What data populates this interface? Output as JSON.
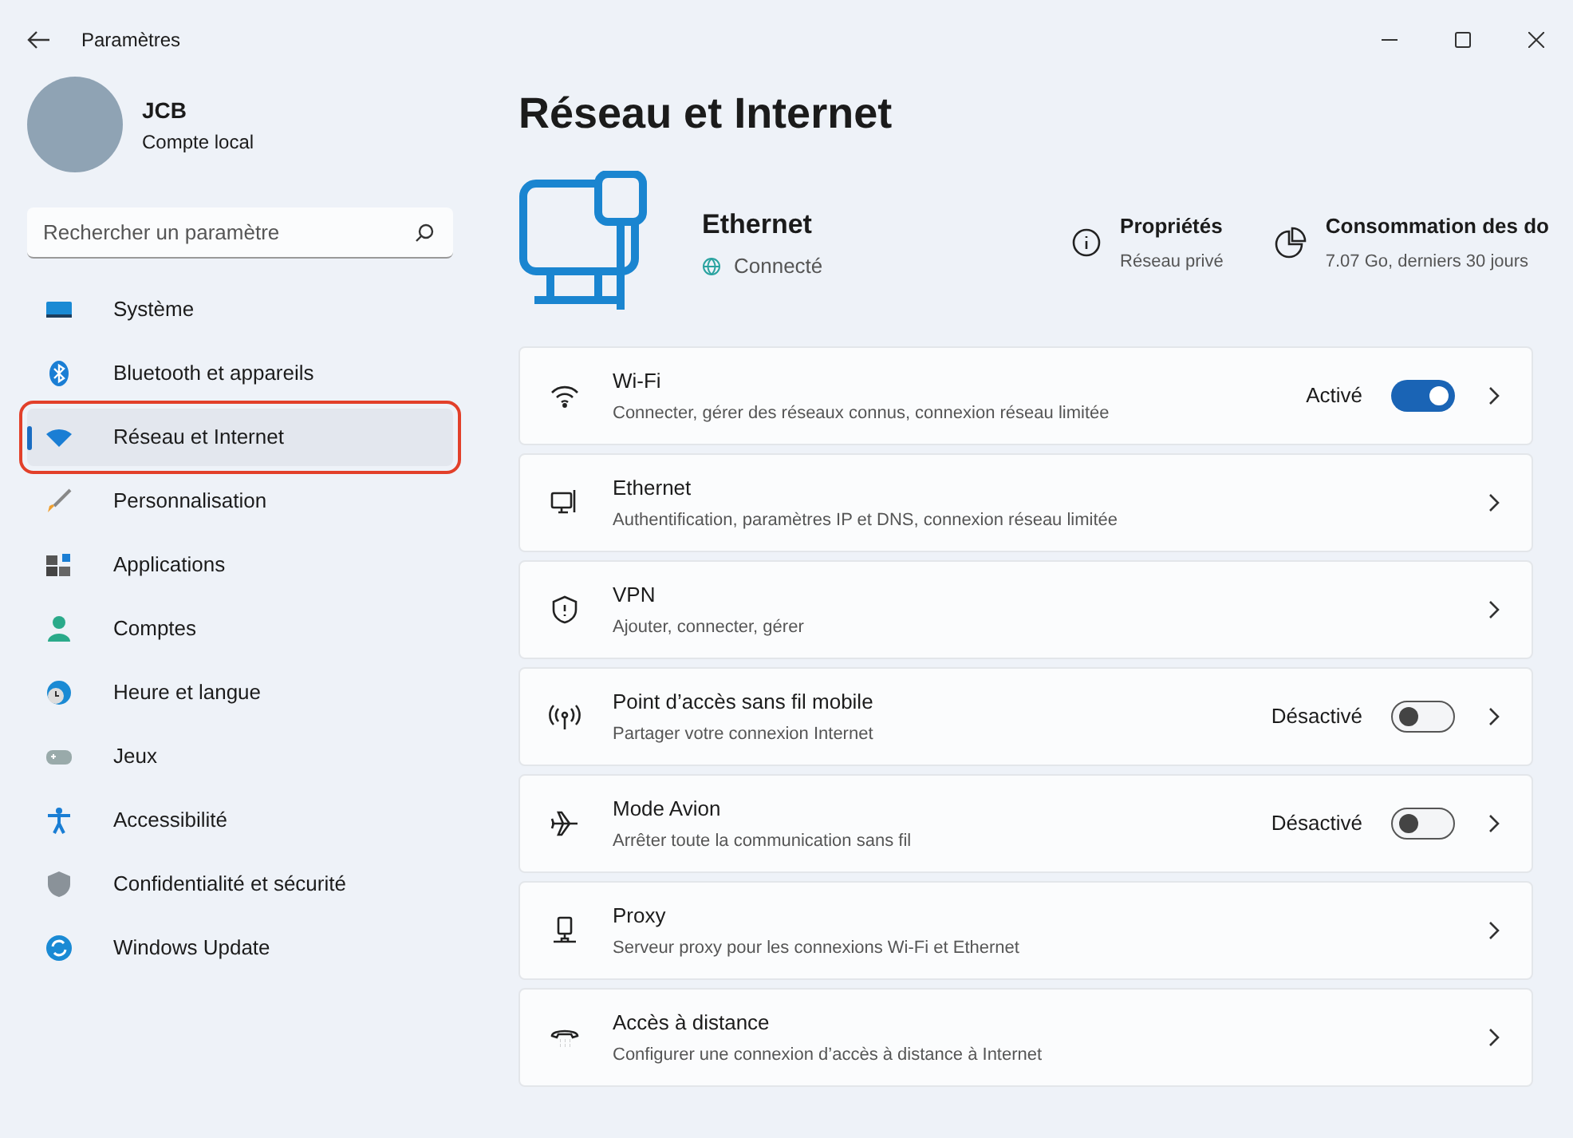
{
  "window": {
    "title": "Paramètres"
  },
  "user": {
    "name": "JCB",
    "account": "Compte local"
  },
  "search": {
    "placeholder": "Rechercher un paramètre"
  },
  "sidebar": {
    "items": [
      {
        "label": "Système",
        "selected": false,
        "highlighted": false
      },
      {
        "label": "Bluetooth et appareils",
        "selected": false,
        "highlighted": false
      },
      {
        "label": "Réseau et Internet",
        "selected": true,
        "highlighted": true
      },
      {
        "label": "Personnalisation",
        "selected": false,
        "highlighted": false
      },
      {
        "label": "Applications",
        "selected": false,
        "highlighted": false
      },
      {
        "label": "Comptes",
        "selected": false,
        "highlighted": false
      },
      {
        "label": "Heure et langue",
        "selected": false,
        "highlighted": false
      },
      {
        "label": "Jeux",
        "selected": false,
        "highlighted": false
      },
      {
        "label": "Accessibilité",
        "selected": false,
        "highlighted": false
      },
      {
        "label": "Confidentialité et sécurité",
        "selected": false,
        "highlighted": false
      },
      {
        "label": "Windows Update",
        "selected": false,
        "highlighted": false
      }
    ]
  },
  "page": {
    "title": "Réseau et Internet",
    "connection": {
      "name": "Ethernet",
      "status": "Connecté"
    },
    "properties": {
      "title": "Propriétés",
      "subtitle": "Réseau privé"
    },
    "usage": {
      "title": "Consommation des do",
      "subtitle": "7.07 Go, derniers 30 jours"
    }
  },
  "settings": [
    {
      "title": "Wi-Fi",
      "description": "Connecter, gérer des réseaux connus, connexion réseau limitée",
      "state_label": "Activé",
      "on": true
    },
    {
      "title": "Ethernet",
      "description": "Authentification, paramètres IP et DNS, connexion réseau limitée"
    },
    {
      "title": "VPN",
      "description": "Ajouter, connecter, gérer"
    },
    {
      "title": "Point d’accès sans fil mobile",
      "description": "Partager votre connexion Internet",
      "state_label": "Désactivé",
      "on": false
    },
    {
      "title": "Mode Avion",
      "description": "Arrêter toute la communication sans fil",
      "state_label": "Désactivé",
      "on": false
    },
    {
      "title": "Proxy",
      "description": "Serveur proxy pour les connexions Wi-Fi et Ethernet"
    },
    {
      "title": "Accès à distance",
      "description": "Configurer une connexion d’accès à distance à Internet"
    }
  ]
}
